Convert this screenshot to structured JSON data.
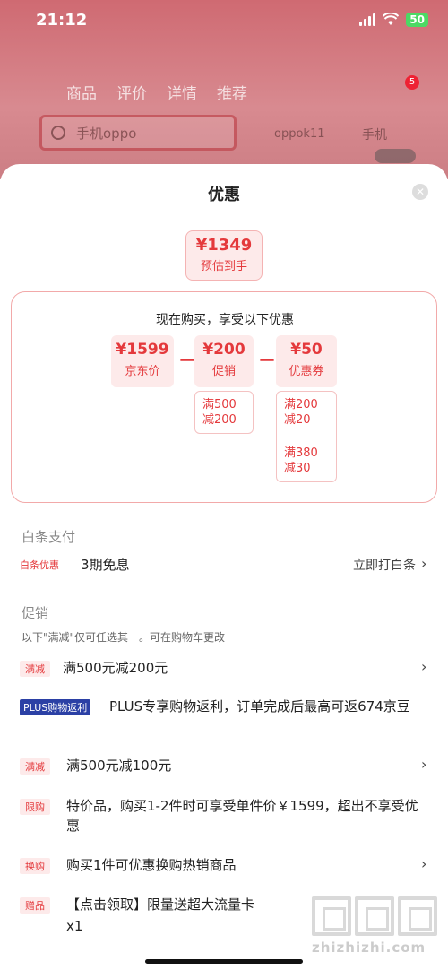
{
  "status_bar": {
    "time": "21:12",
    "battery": "50"
  },
  "background": {
    "nav_tabs": [
      "商品",
      "评价",
      "详情",
      "推荐"
    ],
    "search_placeholder": "手机oppo",
    "search_keywords": [
      "oppok11",
      "手机"
    ],
    "cart_badge": "5"
  },
  "sheet": {
    "title": "优惠",
    "final_price": {
      "amount": "¥1349",
      "label": "预估到手"
    },
    "calc_title": "现在购买，享受以下优惠",
    "jd_price": {
      "amount": "¥1599",
      "label": "京东价"
    },
    "promo": {
      "amount": "¥200",
      "label": "促销",
      "conditions": [
        [
          "满500",
          "减200"
        ]
      ]
    },
    "coupon": {
      "amount": "¥50",
      "label": "优惠券",
      "conditions": [
        [
          "满200",
          "减20"
        ],
        [
          "满380",
          "减30"
        ]
      ]
    },
    "minus_sign": "－"
  },
  "baitiao": {
    "section_title": "白条支付",
    "tag": "白条优惠",
    "text": "3期免息",
    "action": "立即打白条"
  },
  "promotions": {
    "section_title": "促销",
    "note": "以下\"满减\"仅可任选其一。可在购物车更改",
    "items": [
      {
        "tag": "满减",
        "text": "满500元减200元"
      },
      {
        "tag": "PLUS购物返利",
        "text": "PLUS专享购物返利，订单完成后最高可返674京豆"
      },
      {
        "tag": "满减",
        "text": "满500元减100元"
      },
      {
        "tag": "限购",
        "text": "特价品，购买1-2件时可享受单件价￥1599，超出不享受优惠"
      },
      {
        "tag": "换购",
        "text": "购买1件可优惠换购热销商品"
      },
      {
        "tag": "赠品",
        "text": "【点击领取】限量送超大流量卡",
        "sub": "x1"
      }
    ]
  },
  "watermark": {
    "site": "zhizhizhi.com"
  },
  "icons": {
    "close": "close-icon",
    "chevron": "chevron-right-icon"
  }
}
